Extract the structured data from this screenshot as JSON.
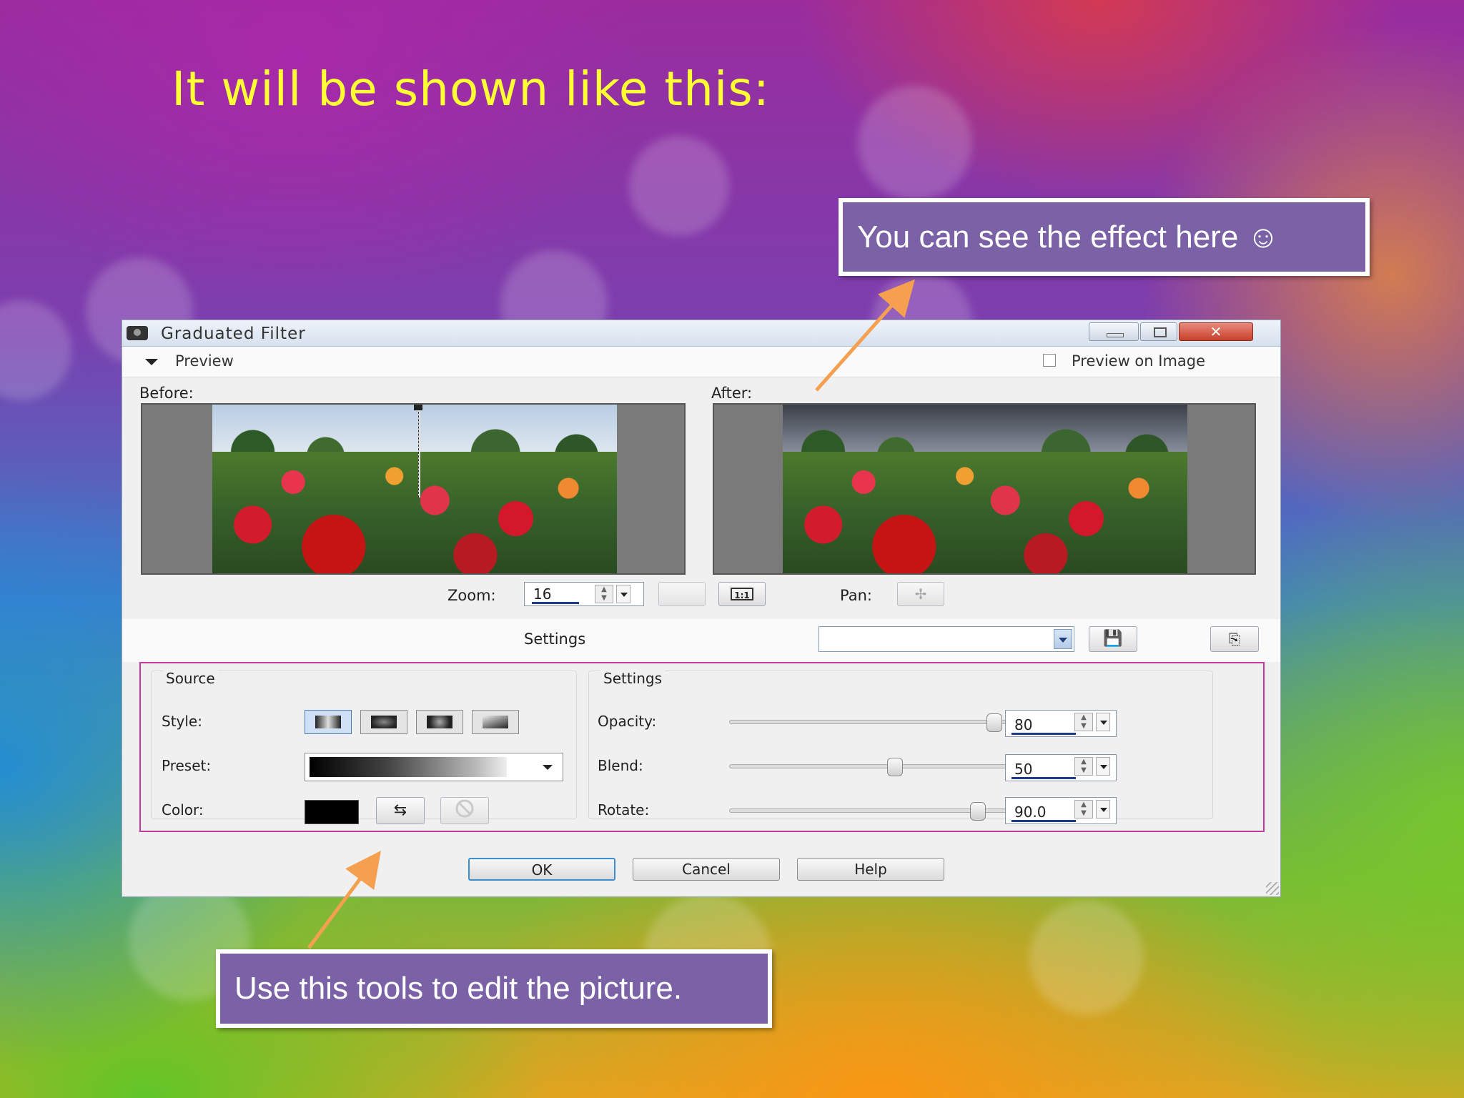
{
  "slide": {
    "title": "It will be shown like this:",
    "callout_effect": "You can see the effect  here ☺",
    "callout_tools": "Use this tools  to edit the picture."
  },
  "colors": {
    "title": "#ffff33",
    "callout_fill": "#7b62a6",
    "arrow": "#f4a050",
    "tools_frame": "#c03a9c"
  },
  "dialog": {
    "title": "Graduated Filter",
    "window_buttons": [
      "minimize-icon",
      "maximize-icon",
      "close-icon"
    ],
    "close_glyph": "✕",
    "preview_toggle_label": "Preview",
    "preview_on_image_label": "Preview on Image",
    "preview_on_image_checked": false,
    "before_label": "Before:",
    "after_label": "After:",
    "zoom_label": "Zoom:",
    "zoom_value": "16",
    "one_to_one_label": "1:1",
    "pan_label": "Pan:",
    "pan_glyph": "✢",
    "settings_label": "Settings",
    "save_glyph": "💾",
    "load_glyph": "⎘",
    "source": {
      "title": "Source",
      "style_label": "Style:",
      "preset_label": "Preset:",
      "color_label": "Color:",
      "swap_glyph": "⇆",
      "none_glyph": "⃠"
    },
    "settings": {
      "title": "Settings",
      "opacity_label": "Opacity:",
      "opacity_value": "80",
      "blend_label": "Blend:",
      "blend_value": "50",
      "rotate_label": "Rotate:",
      "rotate_value": "90.0"
    },
    "buttons": {
      "ok": "OK",
      "cancel": "Cancel",
      "help": "Help"
    }
  }
}
